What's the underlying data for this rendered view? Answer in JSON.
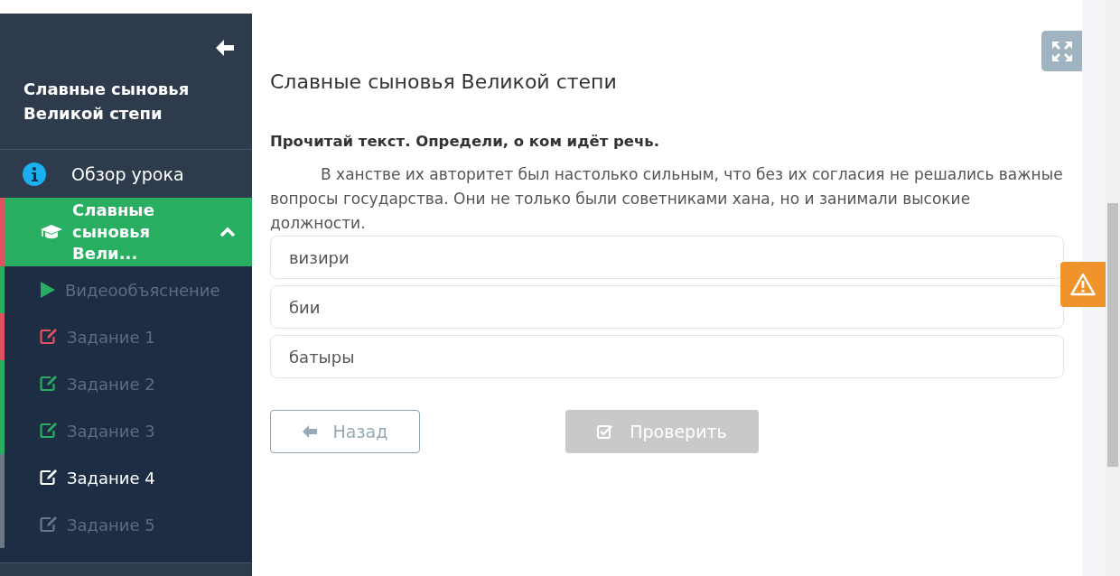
{
  "sidebar": {
    "title": "Славные сыновья Великой степи",
    "overview": {
      "label": "Обзор урока"
    },
    "lesson": {
      "label": "Славные сыновья Вели...",
      "expanded": true,
      "color": "#e0525f"
    },
    "items": [
      {
        "kind": "video",
        "label": "Видеообъяснение",
        "color": "#27ae60",
        "selected": false
      },
      {
        "kind": "task",
        "label": "Задание 1",
        "color": "#e0525f",
        "selected": false
      },
      {
        "kind": "task",
        "label": "Задание 2",
        "color": "#27ae60",
        "selected": false
      },
      {
        "kind": "task",
        "label": "Задание 3",
        "color": "#27ae60",
        "selected": false
      },
      {
        "kind": "task",
        "label": "Задание 4",
        "color": "#6b7785",
        "selected": true
      },
      {
        "kind": "task",
        "label": "Задание 5",
        "color": "#6b7785",
        "selected": false
      }
    ]
  },
  "main": {
    "title": "Славные сыновья Великой степи",
    "question": "Прочитай текст. Определи, о ком идёт речь.",
    "text": "В ханстве их авторитет был настолько сильным, что без их согласия не решались важные вопросы государства. Они не только были советниками хана, но и занимали высокие должности.",
    "options": [
      {
        "label": "визири",
        "selected": false
      },
      {
        "label": "бии",
        "selected": false
      },
      {
        "label": "батыры",
        "selected": false
      }
    ],
    "back_button": {
      "label": "Назад"
    },
    "check_button": {
      "label": "Проверить",
      "disabled": true
    }
  }
}
